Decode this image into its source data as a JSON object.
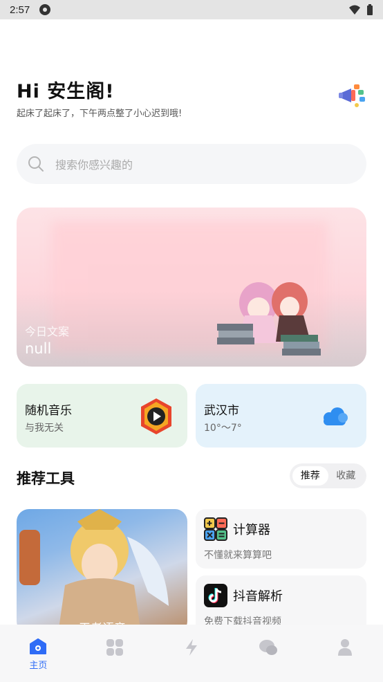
{
  "status_bar": {
    "time": "2:57"
  },
  "header": {
    "title": "Hi 安生阁!",
    "subtitle": "起床了起床了，下午两点整了小心迟到哦!"
  },
  "search": {
    "placeholder": "搜索你感兴趣的"
  },
  "banner": {
    "label": "今日文案",
    "text": "null"
  },
  "music_card": {
    "title": "随机音乐",
    "subtitle": "与我无关"
  },
  "weather_card": {
    "city": "武汉市",
    "temp": "10°～7°"
  },
  "section": {
    "title": "推荐工具"
  },
  "segment": {
    "options": [
      "推荐",
      "收藏"
    ],
    "selected": "推荐"
  },
  "game_card": {
    "text": "王者语音"
  },
  "tools": [
    {
      "title": "计算器",
      "desc": "不懂就来算算吧"
    },
    {
      "title": "抖音解析",
      "desc": "免费下载抖音视频"
    }
  ],
  "tabbar": {
    "home_label": "主页"
  },
  "colors": {
    "accent": "#2f6cf6",
    "music_bg": "#e8f4ea",
    "weather_bg": "#e4f2fb"
  }
}
